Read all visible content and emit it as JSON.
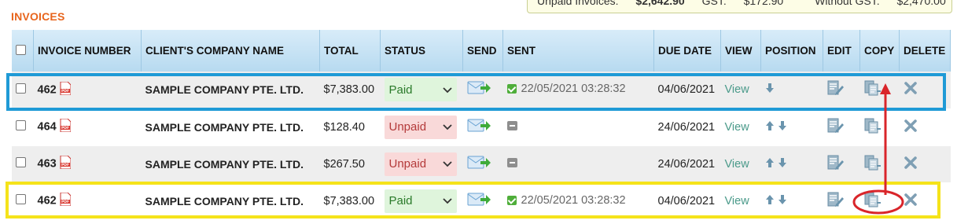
{
  "page": {
    "title": "INVOICES"
  },
  "summary": {
    "unpaid_label": "Unpaid Invoices:",
    "unpaid_value": "$2,642.90",
    "gst_label": "GST:",
    "gst_value": "$172.90",
    "without_gst_label": "Without GST:",
    "without_gst_value": "$2,470.00"
  },
  "table": {
    "headers": {
      "invoice_number": "INVOICE NUMBER",
      "client": "CLIENT'S COMPANY NAME",
      "total": "TOTAL",
      "status": "STATUS",
      "send": "SEND",
      "sent": "SENT",
      "due_date": "DUE DATE",
      "view": "VIEW",
      "position": "POSITION",
      "edit": "EDIT",
      "copy": "COPY",
      "delete": "DELETE"
    },
    "rows": [
      {
        "number": "462",
        "client": "SAMPLE COMPANY PTE. LTD.",
        "total": "$7,383.00",
        "status": "Paid",
        "sent": "22/05/2021 03:28:32",
        "due": "04/06/2021",
        "view": "View"
      },
      {
        "number": "464",
        "client": "SAMPLE COMPANY PTE. LTD.",
        "total": "$128.40",
        "status": "Unpaid",
        "sent": "",
        "due": "24/06/2021",
        "view": "View"
      },
      {
        "number": "463",
        "client": "SAMPLE COMPANY PTE. LTD.",
        "total": "$267.50",
        "status": "Unpaid",
        "sent": "",
        "due": "24/06/2021",
        "view": "View"
      },
      {
        "number": "462",
        "client": "SAMPLE COMPANY PTE. LTD.",
        "total": "$7,383.00",
        "status": "Paid",
        "sent": "22/05/2021 03:28:32",
        "due": "04/06/2021",
        "view": "View"
      }
    ]
  },
  "colors": {
    "title_orange": "#e8651d",
    "header_blue": "#b7daf0",
    "highlight_blue": "#1f9ad6",
    "highlight_yellow": "#f5e31a",
    "arrow_red": "#d9252a",
    "paid_green": "#dff5dc",
    "unpaid_red": "#f9d9d9"
  },
  "icons": [
    "pdf-icon",
    "send-email-icon",
    "sent-check-icon",
    "not-sent-icon",
    "arrow-up-icon",
    "arrow-down-icon",
    "edit-icon",
    "copy-icon",
    "delete-icon",
    "chevron-down-icon"
  ]
}
